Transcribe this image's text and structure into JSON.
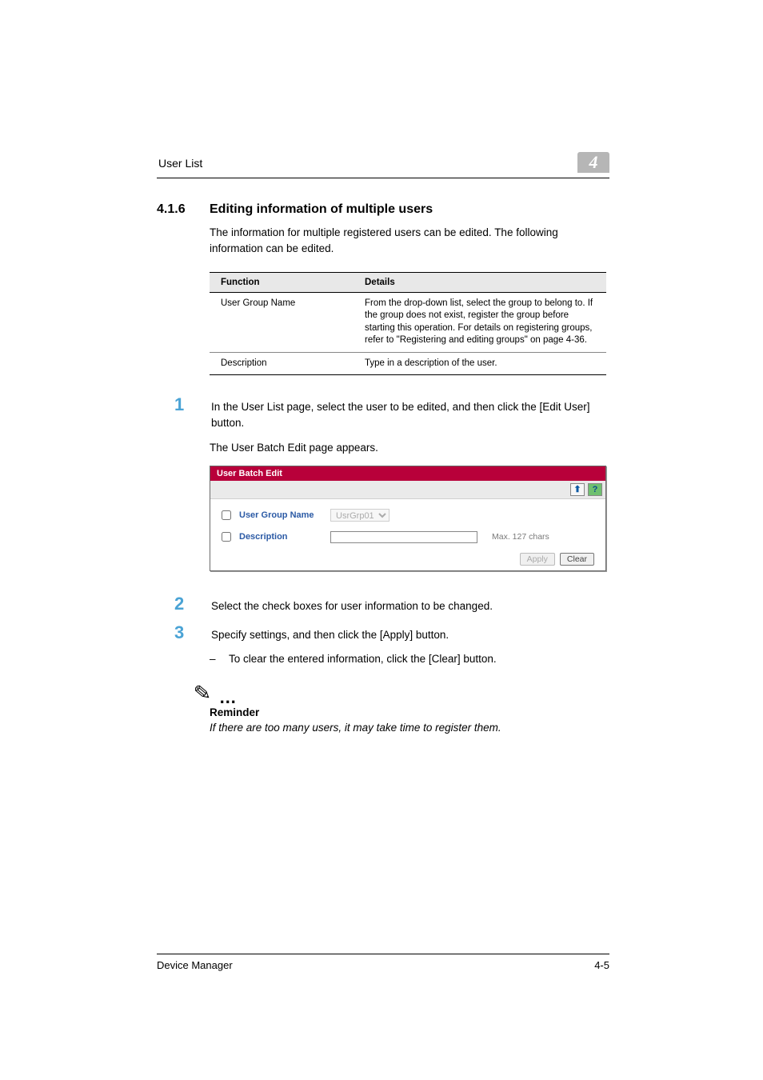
{
  "running_header": {
    "title": "User List",
    "chapter_number": "4"
  },
  "section": {
    "number": "4.1.6",
    "title": "Editing information of multiple users",
    "intro": "The information for multiple registered users can be edited. The following information can be edited."
  },
  "func_table": {
    "head_function": "Function",
    "head_details": "Details",
    "rows": [
      {
        "function": "User Group Name",
        "details": "From the drop-down list, select the group to belong to. If the group does not exist, register the group before starting this operation. For details on registering groups, refer to \"Registering and editing groups\" on page 4-36."
      },
      {
        "function": "Description",
        "details": "Type in a description of the user."
      }
    ]
  },
  "steps": {
    "s1_num": "1",
    "s1_text": "In the User List page, select the user to be edited, and then click the [Edit User] button.",
    "s1_sub": "The User Batch Edit page appears.",
    "s2_num": "2",
    "s2_text": "Select the check boxes for user information to be changed.",
    "s3_num": "3",
    "s3_text": "Specify settings, and then click the [Apply] button.",
    "s3_dash": "To clear the entered information, click the [Clear] button."
  },
  "ui": {
    "title": "User Batch Edit",
    "up_glyph": "⬆",
    "help_glyph": "?",
    "row_group_label": "User Group Name",
    "row_group_select_option": "UsrGrp01",
    "row_desc_label": "Description",
    "row_desc_value": "",
    "row_desc_hint": "Max. 127 chars",
    "btn_apply": "Apply",
    "btn_clear": "Clear"
  },
  "reminder": {
    "icon": "✎",
    "dots": "…",
    "title": "Reminder",
    "body": "If there are too many users, it may take time to register them."
  },
  "footer": {
    "left": "Device Manager",
    "right": "4-5"
  }
}
